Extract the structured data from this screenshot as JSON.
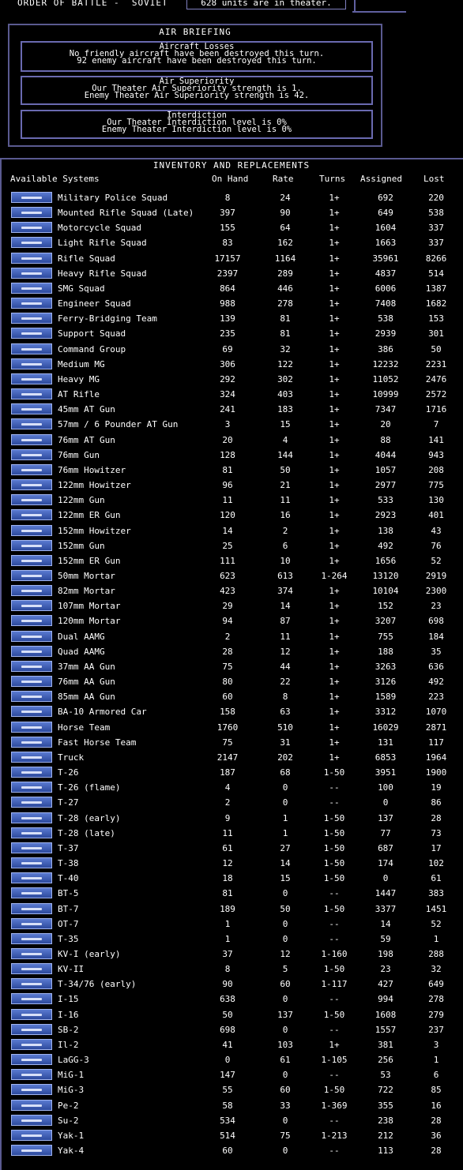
{
  "header": {
    "title": "ORDER OF BATTLE -  SOVIET",
    "units_in_theater": "628 units are in theater."
  },
  "air_briefing": {
    "title": "AIR BRIEFING",
    "aircraft_losses": {
      "heading": "Aircraft Losses",
      "line1": "No friendly aircraft have been destroyed this turn.",
      "line2": "92 enemy aircraft have been destroyed this turn."
    },
    "air_superiority": {
      "heading": "Air Superiority",
      "line1": "Our Theater Air Superiority strength is 1.",
      "line2": "Enemy Theater Air Superiority strength is 42."
    },
    "interdiction": {
      "heading": "Interdiction",
      "line1": "Our Theater Interdiction level is 0%",
      "line2": "Enemy Theater Interdiction level is 0%"
    }
  },
  "inventory": {
    "title": "INVENTORY AND REPLACEMENTS",
    "columns": {
      "system": "Available Systems",
      "on_hand": "On Hand",
      "rate": "Rate",
      "turns": "Turns",
      "assigned": "Assigned",
      "lost": "Lost"
    },
    "rows": [
      {
        "name": "Military Police Squad",
        "on_hand": "8",
        "rate": "24",
        "turns": "1+",
        "assigned": "692",
        "lost": "220",
        "icon": "infantry-icon"
      },
      {
        "name": "Mounted Rifle Squad (Late)",
        "on_hand": "397",
        "rate": "90",
        "turns": "1+",
        "assigned": "649",
        "lost": "538",
        "icon": "cavalry-icon"
      },
      {
        "name": "Motorcycle Squad",
        "on_hand": "155",
        "rate": "64",
        "turns": "1+",
        "assigned": "1604",
        "lost": "337",
        "icon": "motorcycle-icon"
      },
      {
        "name": "Light Rifle Squad",
        "on_hand": "83",
        "rate": "162",
        "turns": "1+",
        "assigned": "1663",
        "lost": "337",
        "icon": "rifle-icon"
      },
      {
        "name": "Rifle Squad",
        "on_hand": "17157",
        "rate": "1164",
        "turns": "1+",
        "assigned": "35961",
        "lost": "8266",
        "icon": "rifle-icon"
      },
      {
        "name": "Heavy Rifle Squad",
        "on_hand": "2397",
        "rate": "289",
        "turns": "1+",
        "assigned": "4837",
        "lost": "514",
        "icon": "rifle-icon"
      },
      {
        "name": "SMG Squad",
        "on_hand": "864",
        "rate": "446",
        "turns": "1+",
        "assigned": "6006",
        "lost": "1387",
        "icon": "smg-icon"
      },
      {
        "name": "Engineer Squad",
        "on_hand": "988",
        "rate": "278",
        "turns": "1+",
        "assigned": "7408",
        "lost": "1682",
        "icon": "engineer-icon"
      },
      {
        "name": "Ferry-Bridging Team",
        "on_hand": "139",
        "rate": "81",
        "turns": "1+",
        "assigned": "538",
        "lost": "153",
        "icon": "engineer-icon"
      },
      {
        "name": "Support Squad",
        "on_hand": "235",
        "rate": "81",
        "turns": "1+",
        "assigned": "2939",
        "lost": "301",
        "icon": "support-icon"
      },
      {
        "name": "Command Group",
        "on_hand": "69",
        "rate": "32",
        "turns": "1+",
        "assigned": "386",
        "lost": "50",
        "icon": "command-icon"
      },
      {
        "name": "Medium MG",
        "on_hand": "306",
        "rate": "122",
        "turns": "1+",
        "assigned": "12232",
        "lost": "2231",
        "icon": "machine-gun-icon"
      },
      {
        "name": "Heavy MG",
        "on_hand": "292",
        "rate": "302",
        "turns": "1+",
        "assigned": "11052",
        "lost": "2476",
        "icon": "machine-gun-icon"
      },
      {
        "name": "AT Rifle",
        "on_hand": "324",
        "rate": "403",
        "turns": "1+",
        "assigned": "10999",
        "lost": "2572",
        "icon": "at-rifle-icon"
      },
      {
        "name": "45mm AT Gun",
        "on_hand": "241",
        "rate": "183",
        "turns": "1+",
        "assigned": "7347",
        "lost": "1716",
        "icon": "at-gun-icon"
      },
      {
        "name": "57mm / 6 Pounder AT Gun",
        "on_hand": "3",
        "rate": "15",
        "turns": "1+",
        "assigned": "20",
        "lost": "7",
        "icon": "at-gun-icon"
      },
      {
        "name": "76mm AT Gun",
        "on_hand": "20",
        "rate": "4",
        "turns": "1+",
        "assigned": "88",
        "lost": "141",
        "icon": "at-gun-icon"
      },
      {
        "name": "76mm Gun",
        "on_hand": "128",
        "rate": "144",
        "turns": "1+",
        "assigned": "4044",
        "lost": "943",
        "icon": "field-gun-icon"
      },
      {
        "name": "76mm Howitzer",
        "on_hand": "81",
        "rate": "50",
        "turns": "1+",
        "assigned": "1057",
        "lost": "208",
        "icon": "howitzer-icon"
      },
      {
        "name": "122mm Howitzer",
        "on_hand": "96",
        "rate": "21",
        "turns": "1+",
        "assigned": "2977",
        "lost": "775",
        "icon": "howitzer-icon"
      },
      {
        "name": "122mm Gun",
        "on_hand": "11",
        "rate": "11",
        "turns": "1+",
        "assigned": "533",
        "lost": "130",
        "icon": "field-gun-icon"
      },
      {
        "name": "122mm ER Gun",
        "on_hand": "120",
        "rate": "16",
        "turns": "1+",
        "assigned": "2923",
        "lost": "401",
        "icon": "field-gun-icon"
      },
      {
        "name": "152mm Howitzer",
        "on_hand": "14",
        "rate": "2",
        "turns": "1+",
        "assigned": "138",
        "lost": "43",
        "icon": "howitzer-icon"
      },
      {
        "name": "152mm Gun",
        "on_hand": "25",
        "rate": "6",
        "turns": "1+",
        "assigned": "492",
        "lost": "76",
        "icon": "field-gun-icon"
      },
      {
        "name": "152mm ER Gun",
        "on_hand": "111",
        "rate": "10",
        "turns": "1+",
        "assigned": "1656",
        "lost": "52",
        "icon": "field-gun-icon"
      },
      {
        "name": "50mm Mortar",
        "on_hand": "623",
        "rate": "613",
        "turns": "1-264",
        "assigned": "13120",
        "lost": "2919",
        "icon": "mortar-icon"
      },
      {
        "name": "82mm Mortar",
        "on_hand": "423",
        "rate": "374",
        "turns": "1+",
        "assigned": "10104",
        "lost": "2300",
        "icon": "mortar-icon"
      },
      {
        "name": "107mm Mortar",
        "on_hand": "29",
        "rate": "14",
        "turns": "1+",
        "assigned": "152",
        "lost": "23",
        "icon": "mortar-icon"
      },
      {
        "name": "120mm Mortar",
        "on_hand": "94",
        "rate": "87",
        "turns": "1+",
        "assigned": "3207",
        "lost": "698",
        "icon": "mortar-icon"
      },
      {
        "name": "Dual AAMG",
        "on_hand": "2",
        "rate": "11",
        "turns": "1+",
        "assigned": "755",
        "lost": "184",
        "icon": "aa-mg-icon"
      },
      {
        "name": "Quad AAMG",
        "on_hand": "28",
        "rate": "12",
        "turns": "1+",
        "assigned": "188",
        "lost": "35",
        "icon": "aa-mg-icon"
      },
      {
        "name": "37mm AA Gun",
        "on_hand": "75",
        "rate": "44",
        "turns": "1+",
        "assigned": "3263",
        "lost": "636",
        "icon": "aa-gun-icon"
      },
      {
        "name": "76mm AA Gun",
        "on_hand": "80",
        "rate": "22",
        "turns": "1+",
        "assigned": "3126",
        "lost": "492",
        "icon": "aa-gun-icon"
      },
      {
        "name": "85mm AA Gun",
        "on_hand": "60",
        "rate": "8",
        "turns": "1+",
        "assigned": "1589",
        "lost": "223",
        "icon": "aa-gun-icon"
      },
      {
        "name": "BA-10 Armored Car",
        "on_hand": "158",
        "rate": "63",
        "turns": "1+",
        "assigned": "3312",
        "lost": "1070",
        "icon": "armored-car-icon"
      },
      {
        "name": "Horse Team",
        "on_hand": "1760",
        "rate": "510",
        "turns": "1+",
        "assigned": "16029",
        "lost": "2871",
        "icon": "horse-icon"
      },
      {
        "name": "Fast Horse Team",
        "on_hand": "75",
        "rate": "31",
        "turns": "1+",
        "assigned": "131",
        "lost": "117",
        "icon": "horse-icon"
      },
      {
        "name": "Truck",
        "on_hand": "2147",
        "rate": "202",
        "turns": "1+",
        "assigned": "6853",
        "lost": "1964",
        "icon": "truck-icon"
      },
      {
        "name": "T-26",
        "on_hand": "187",
        "rate": "68",
        "turns": "1-50",
        "assigned": "3951",
        "lost": "1900",
        "icon": "tank-icon"
      },
      {
        "name": "T-26 (flame)",
        "on_hand": "4",
        "rate": "0",
        "turns": "--",
        "assigned": "100",
        "lost": "19",
        "icon": "tank-icon"
      },
      {
        "name": "T-27",
        "on_hand": "2",
        "rate": "0",
        "turns": "--",
        "assigned": "0",
        "lost": "86",
        "icon": "tankette-icon"
      },
      {
        "name": "T-28 (early)",
        "on_hand": "9",
        "rate": "1",
        "turns": "1-50",
        "assigned": "137",
        "lost": "28",
        "icon": "tank-icon"
      },
      {
        "name": "T-28 (late)",
        "on_hand": "11",
        "rate": "1",
        "turns": "1-50",
        "assigned": "77",
        "lost": "73",
        "icon": "tank-icon"
      },
      {
        "name": "T-37",
        "on_hand": "61",
        "rate": "27",
        "turns": "1-50",
        "assigned": "687",
        "lost": "17",
        "icon": "tank-icon"
      },
      {
        "name": "T-38",
        "on_hand": "12",
        "rate": "14",
        "turns": "1-50",
        "assigned": "174",
        "lost": "102",
        "icon": "tank-icon"
      },
      {
        "name": "T-40",
        "on_hand": "18",
        "rate": "15",
        "turns": "1-50",
        "assigned": "0",
        "lost": "61",
        "icon": "tank-icon"
      },
      {
        "name": "BT-5",
        "on_hand": "81",
        "rate": "0",
        "turns": "--",
        "assigned": "1447",
        "lost": "383",
        "icon": "tank-icon"
      },
      {
        "name": "BT-7",
        "on_hand": "189",
        "rate": "50",
        "turns": "1-50",
        "assigned": "3377",
        "lost": "1451",
        "icon": "tank-icon"
      },
      {
        "name": "OT-7",
        "on_hand": "1",
        "rate": "0",
        "turns": "--",
        "assigned": "14",
        "lost": "52",
        "icon": "tank-icon"
      },
      {
        "name": "T-35",
        "on_hand": "1",
        "rate": "0",
        "turns": "--",
        "assigned": "59",
        "lost": "1",
        "icon": "heavy-tank-icon"
      },
      {
        "name": "KV-I (early)",
        "on_hand": "37",
        "rate": "12",
        "turns": "1-160",
        "assigned": "198",
        "lost": "288",
        "icon": "heavy-tank-icon"
      },
      {
        "name": "KV-II",
        "on_hand": "8",
        "rate": "5",
        "turns": "1-50",
        "assigned": "23",
        "lost": "32",
        "icon": "heavy-tank-icon"
      },
      {
        "name": "T-34/76 (early)",
        "on_hand": "90",
        "rate": "60",
        "turns": "1-117",
        "assigned": "427",
        "lost": "649",
        "icon": "tank-icon"
      },
      {
        "name": "I-15",
        "on_hand": "638",
        "rate": "0",
        "turns": "--",
        "assigned": "994",
        "lost": "278",
        "icon": "aircraft-icon"
      },
      {
        "name": "I-16",
        "on_hand": "50",
        "rate": "137",
        "turns": "1-50",
        "assigned": "1608",
        "lost": "279",
        "icon": "aircraft-icon"
      },
      {
        "name": "SB-2",
        "on_hand": "698",
        "rate": "0",
        "turns": "--",
        "assigned": "1557",
        "lost": "237",
        "icon": "aircraft-icon"
      },
      {
        "name": "Il-2",
        "on_hand": "41",
        "rate": "103",
        "turns": "1+",
        "assigned": "381",
        "lost": "3",
        "icon": "aircraft-icon"
      },
      {
        "name": "LaGG-3",
        "on_hand": "0",
        "rate": "61",
        "turns": "1-105",
        "assigned": "256",
        "lost": "1",
        "icon": "aircraft-icon"
      },
      {
        "name": "MiG-1",
        "on_hand": "147",
        "rate": "0",
        "turns": "--",
        "assigned": "53",
        "lost": "6",
        "icon": "aircraft-icon"
      },
      {
        "name": "MiG-3",
        "on_hand": "55",
        "rate": "60",
        "turns": "1-50",
        "assigned": "722",
        "lost": "85",
        "icon": "aircraft-icon"
      },
      {
        "name": "Pe-2",
        "on_hand": "58",
        "rate": "33",
        "turns": "1-369",
        "assigned": "355",
        "lost": "16",
        "icon": "aircraft-icon"
      },
      {
        "name": "Su-2",
        "on_hand": "534",
        "rate": "0",
        "turns": "--",
        "assigned": "238",
        "lost": "28",
        "icon": "aircraft-icon"
      },
      {
        "name": "Yak-1",
        "on_hand": "514",
        "rate": "75",
        "turns": "1-213",
        "assigned": "212",
        "lost": "36",
        "icon": "aircraft-icon"
      },
      {
        "name": "Yak-4",
        "on_hand": "60",
        "rate": "0",
        "turns": "--",
        "assigned": "113",
        "lost": "28",
        "icon": "aircraft-icon"
      }
    ]
  },
  "colors": {
    "background": "#000000",
    "text": "#ffffff",
    "panel_border": "#5a5a90",
    "icon_fill": "#3a5ab8"
  }
}
